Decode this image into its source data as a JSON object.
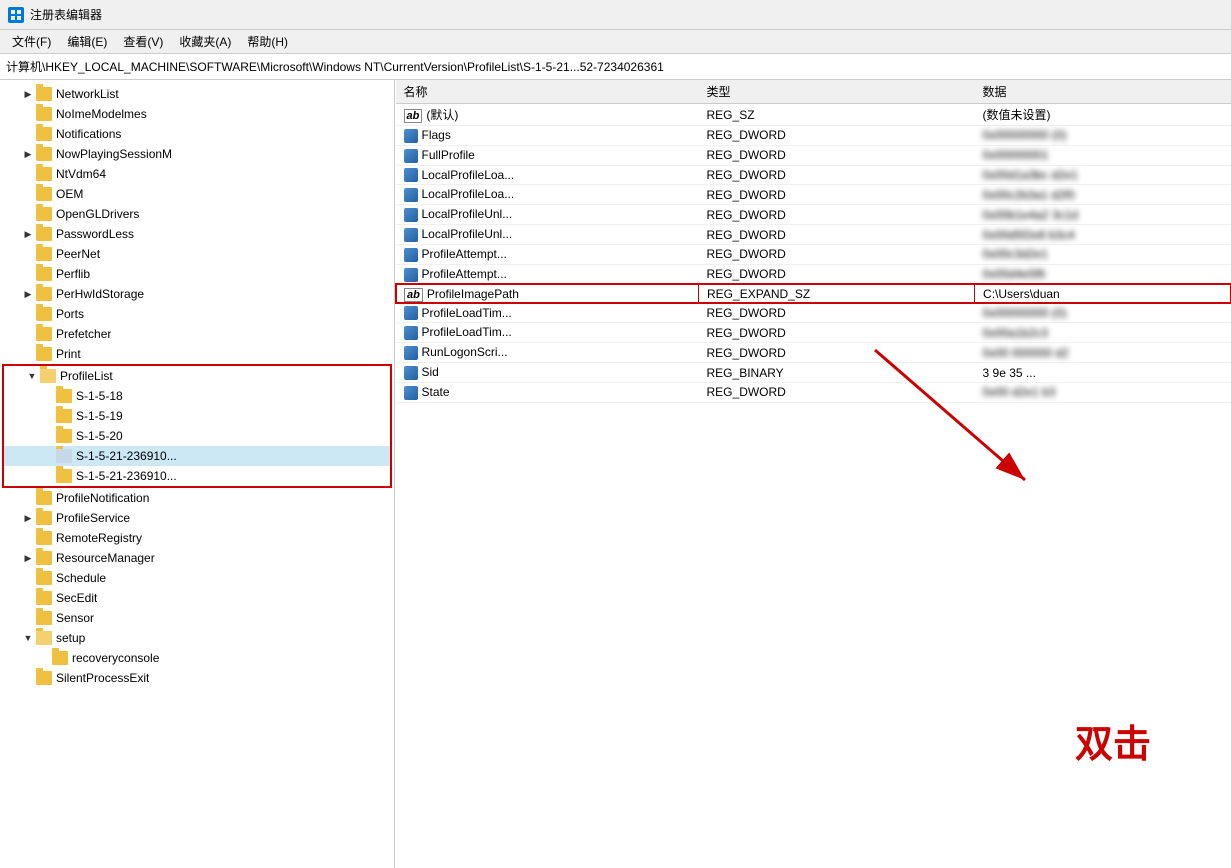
{
  "titleBar": {
    "icon": "🗂",
    "title": "注册表编辑器"
  },
  "menuBar": {
    "items": [
      "文件(F)",
      "编辑(E)",
      "查看(V)",
      "收藏夹(A)",
      "帮助(H)"
    ]
  },
  "addressBar": {
    "path": "计算机\\HKEY_LOCAL_MACHINE\\SOFTWARE\\Microsoft\\Windows NT\\CurrentVersion\\ProfileList\\S-1-5-21...52-7234026361"
  },
  "treeItems": [
    {
      "label": "NetworkList",
      "indent": 1,
      "arrow": "collapsed"
    },
    {
      "label": "NoImeModelmes",
      "indent": 1,
      "arrow": "leaf"
    },
    {
      "label": "Notifications",
      "indent": 1,
      "arrow": "leaf",
      "selected": false
    },
    {
      "label": "NowPlayingSessionM",
      "indent": 1,
      "arrow": "collapsed"
    },
    {
      "label": "NtVdm64",
      "indent": 1,
      "arrow": "leaf"
    },
    {
      "label": "OEM",
      "indent": 1,
      "arrow": "leaf"
    },
    {
      "label": "OpenGLDrivers",
      "indent": 1,
      "arrow": "leaf"
    },
    {
      "label": "PasswordLess",
      "indent": 1,
      "arrow": "collapsed"
    },
    {
      "label": "PeerNet",
      "indent": 1,
      "arrow": "leaf"
    },
    {
      "label": "Perflib",
      "indent": 1,
      "arrow": "leaf"
    },
    {
      "label": "PerHwIdStorage",
      "indent": 1,
      "arrow": "collapsed"
    },
    {
      "label": "Ports",
      "indent": 1,
      "arrow": "leaf"
    },
    {
      "label": "Prefetcher",
      "indent": 1,
      "arrow": "leaf"
    },
    {
      "label": "Print",
      "indent": 1,
      "arrow": "leaf"
    },
    {
      "label": "ProfileList",
      "indent": 1,
      "arrow": "expanded",
      "inBox": true
    },
    {
      "label": "S-1-5-18",
      "indent": 2,
      "arrow": "leaf",
      "inBox": true
    },
    {
      "label": "S-1-5-19",
      "indent": 2,
      "arrow": "leaf",
      "inBox": true
    },
    {
      "label": "S-1-5-20",
      "indent": 2,
      "arrow": "leaf",
      "inBox": true
    },
    {
      "label": "S-1-5-21-236910",
      "indent": 2,
      "arrow": "leaf",
      "inBox": true,
      "selected": true
    },
    {
      "label": "S-1-5-21-236910",
      "indent": 2,
      "arrow": "leaf",
      "inBox": true
    },
    {
      "label": "ProfileNotification",
      "indent": 1,
      "arrow": "leaf"
    },
    {
      "label": "ProfileService",
      "indent": 1,
      "arrow": "collapsed"
    },
    {
      "label": "RemoteRegistry",
      "indent": 1,
      "arrow": "leaf"
    },
    {
      "label": "ResourceManager",
      "indent": 1,
      "arrow": "collapsed"
    },
    {
      "label": "Schedule",
      "indent": 1,
      "arrow": "leaf"
    },
    {
      "label": "SecEdit",
      "indent": 1,
      "arrow": "leaf"
    },
    {
      "label": "Sensor",
      "indent": 1,
      "arrow": "leaf"
    },
    {
      "label": "setup",
      "indent": 1,
      "arrow": "expanded"
    },
    {
      "label": "recoveryconsole",
      "indent": 2,
      "arrow": "leaf"
    },
    {
      "label": "SilentProcessExit",
      "indent": 1,
      "arrow": "leaf"
    }
  ],
  "tableHeaders": [
    "名称",
    "类型",
    "数据"
  ],
  "tableRows": [
    {
      "icon": "ab",
      "name": "(默认)",
      "type": "REG_SZ",
      "data": "(数值未设置)",
      "blurred": false
    },
    {
      "icon": "dw",
      "name": "Flags",
      "type": "REG_DWORD",
      "data": "█▓▒░  (0)",
      "blurred": true
    },
    {
      "icon": "dw",
      "name": "FullProfile",
      "type": "REG_DWORD",
      "data": "█▓▒░▓█",
      "blurred": true
    },
    {
      "icon": "dw",
      "name": "LocalProfileLoa...",
      "type": "REG_DWORD",
      "data": "█▓▒ ░▓█  ██",
      "blurred": true
    },
    {
      "icon": "dw",
      "name": "LocalProfileLoa...",
      "type": "REG_DWORD",
      "data": "█▓▒░  ▓█ ██",
      "blurred": true
    },
    {
      "icon": "dw",
      "name": "LocalProfileUnl...",
      "type": "REG_DWORD",
      "data": "█▓▒ ▓█ ░██",
      "blurred": true
    },
    {
      "icon": "dw",
      "name": "LocalProfileUnl...",
      "type": "REG_DWORD",
      "data": "█▓▒░▓  ██▓",
      "blurred": true
    },
    {
      "icon": "dw",
      "name": "ProfileAttempt...",
      "type": "REG_DWORD",
      "data": "█▓▒░▓█▒",
      "blurred": true
    },
    {
      "icon": "dw",
      "name": "ProfileAttempt...",
      "type": "REG_DWORD",
      "data": "█▓▒░▓█",
      "blurred": true
    },
    {
      "icon": "ab",
      "name": "ProfileImagePath",
      "type": "REG_EXPAND_SZ",
      "data": "C:\\Users\\duan",
      "blurred": false,
      "highlighted": true
    },
    {
      "icon": "dw",
      "name": "ProfileLoadTim...",
      "type": "REG_DWORD",
      "data": "█▓▒░  (0)",
      "blurred": true
    },
    {
      "icon": "dw",
      "name": "ProfileLoadTim...",
      "type": "REG_DWORD",
      "data": "█▓▒░▓█",
      "blurred": true
    },
    {
      "icon": "dw",
      "name": "RunLogonScri...",
      "type": "REG_DWORD",
      "data": "█  ░░░░  █",
      "blurred": true
    },
    {
      "icon": "dw",
      "name": "Sid",
      "type": "REG_BINARY",
      "data": "3 9e 35 ...",
      "blurred": false
    },
    {
      "icon": "dw",
      "name": "State",
      "type": "REG_DWORD",
      "data": "█▓  ██  █",
      "blurred": true
    }
  ],
  "annotation": {
    "doubleClickText": "双击",
    "arrowColor": "#cc0000"
  }
}
